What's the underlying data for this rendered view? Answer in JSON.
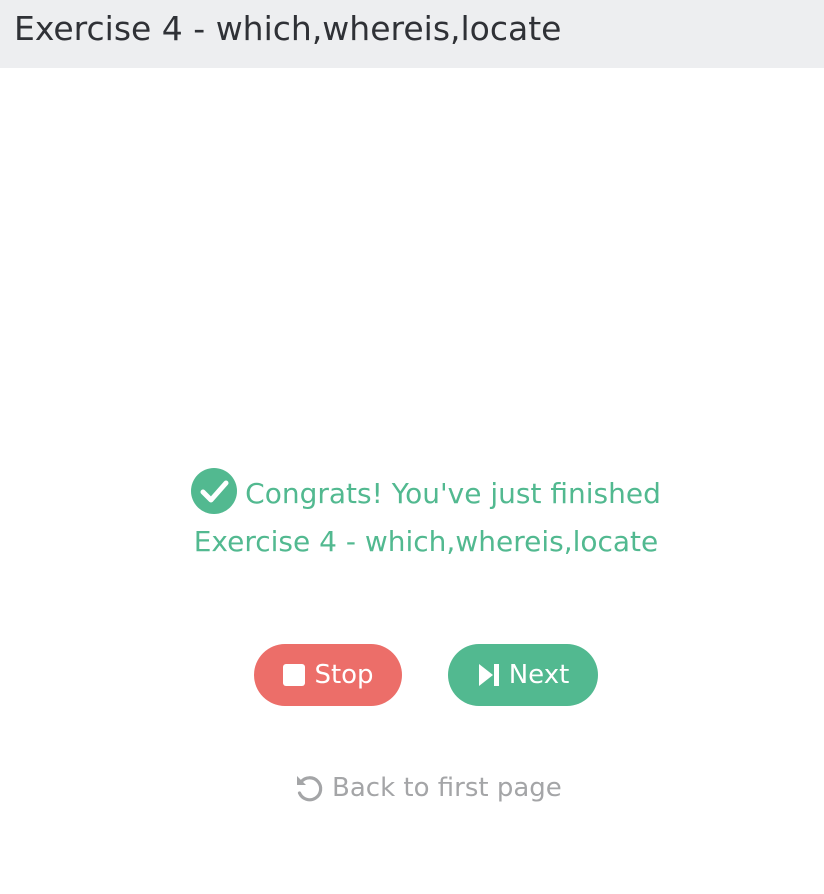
{
  "header": {
    "title": "Exercise 4 - which,whereis,locate"
  },
  "completion": {
    "message": "Congrats! You've just finished",
    "exercise_name": "Exercise 4 - which,whereis,locate",
    "icon": "check-circle-icon"
  },
  "actions": {
    "stop_label": "Stop",
    "stop_icon": "stop-square-icon",
    "next_label": "Next",
    "next_icon": "skip-next-icon",
    "back_label": "Back to first page",
    "back_icon": "undo-arrow-icon"
  },
  "colors": {
    "success": "#52b990",
    "danger": "#ec6e69",
    "muted": "#a4a5a7",
    "header_bg": "#edeef0"
  }
}
